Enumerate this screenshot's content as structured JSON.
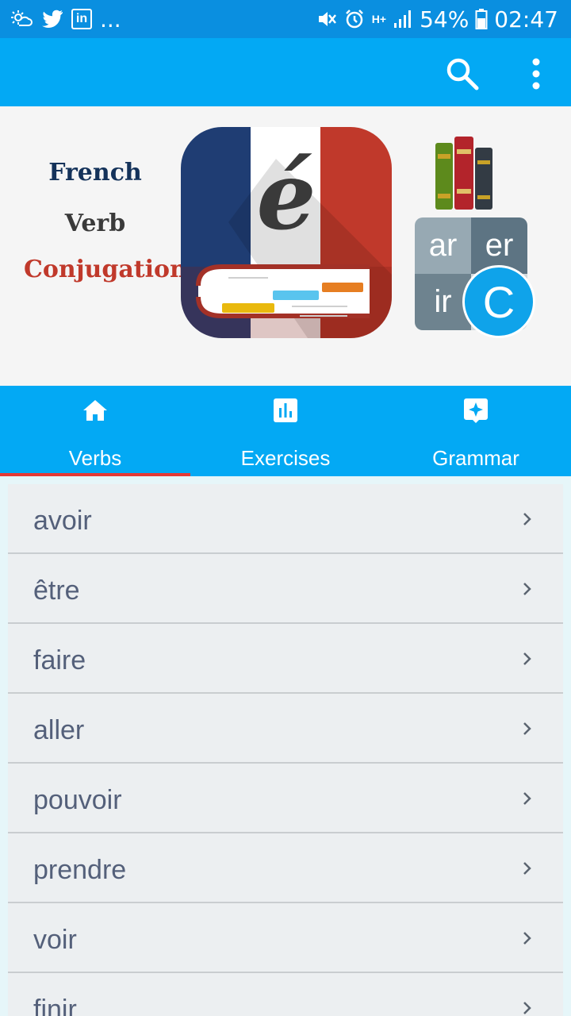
{
  "status_bar": {
    "overflow": "...",
    "network": "H+",
    "battery": "54%",
    "time": "02:47",
    "icons": [
      "weather-icon",
      "twitter-icon",
      "linkedin-icon",
      "mute-icon",
      "alarm-icon",
      "signal-icon",
      "battery-icon"
    ]
  },
  "app_bar": {
    "icons": [
      "search-icon",
      "more-vert-icon"
    ]
  },
  "banner": {
    "line1": "French",
    "line2": "Verb",
    "line3": "Conjugation",
    "logo_letter": "é",
    "grid": [
      "ar",
      "er",
      "ir"
    ],
    "circle_letter": "C"
  },
  "tabs": [
    {
      "label": "Verbs",
      "icon": "home-icon",
      "selected": true
    },
    {
      "label": "Exercises",
      "icon": "chart-icon",
      "selected": false
    },
    {
      "label": "Grammar",
      "icon": "sparkle-icon",
      "selected": false
    }
  ],
  "verbs": [
    "avoir",
    "être",
    "faire",
    "aller",
    "pouvoir",
    "prendre",
    "voir",
    "finir"
  ],
  "colors": {
    "status_bar": "#0a8fe0",
    "primary": "#03a9f4",
    "tab_indicator": "#e53935",
    "list_background": "#eceff1",
    "verb_text": "#54607a"
  }
}
